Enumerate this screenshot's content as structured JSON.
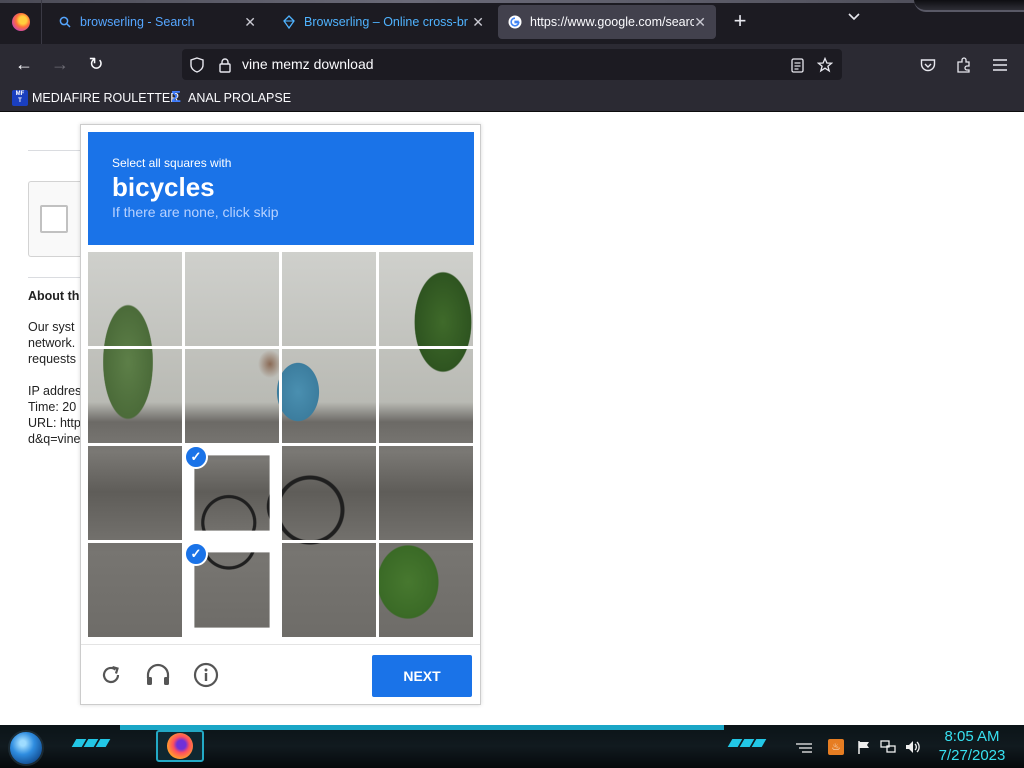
{
  "tabs": [
    {
      "label": "browserling - Search",
      "icon": "search-icon",
      "active": false
    },
    {
      "label": "Browserling – Online cross-bro",
      "icon": "browserling-icon",
      "active": false
    },
    {
      "label": "https://www.google.com/searc",
      "icon": "google-icon",
      "active": true
    }
  ],
  "tab_close_glyph": "✕",
  "new_tab_glyph": "+",
  "tab_list_glyph": "⌄",
  "nav": {
    "back": "←",
    "forward": "→",
    "reload": "↻",
    "url": "vine memz download"
  },
  "bookmarks": [
    {
      "label": "MEDIAFIRE ROULETTER",
      "icon": "mediafire-icon",
      "icon_text": "MF\nT"
    },
    {
      "label": "ANAL PROLAPSE",
      "icon": "sigma-icon",
      "icon_text": "Σ"
    }
  ],
  "page_behind": {
    "heading": "About th",
    "lines": [
      "Our syst",
      "network.",
      "requests",
      "IP addres",
      "Time: 20",
      "URL: http",
      "d&q=vine"
    ]
  },
  "captcha": {
    "instruction": "Select all squares with",
    "target": "bicycles",
    "hint": "If there are none, click skip",
    "selected_cells": [
      9,
      13
    ],
    "next_label": "NEXT",
    "footer_icons": [
      "reload-icon",
      "audio-icon",
      "info-icon"
    ]
  },
  "taskbar": {
    "time": "8:05 AM",
    "date": "7/27/2023"
  },
  "colors": {
    "accent": "#1a73e8",
    "tabbar": "#1c1b22",
    "toolbar": "#2b2a33",
    "clock": "#37e0f0"
  }
}
